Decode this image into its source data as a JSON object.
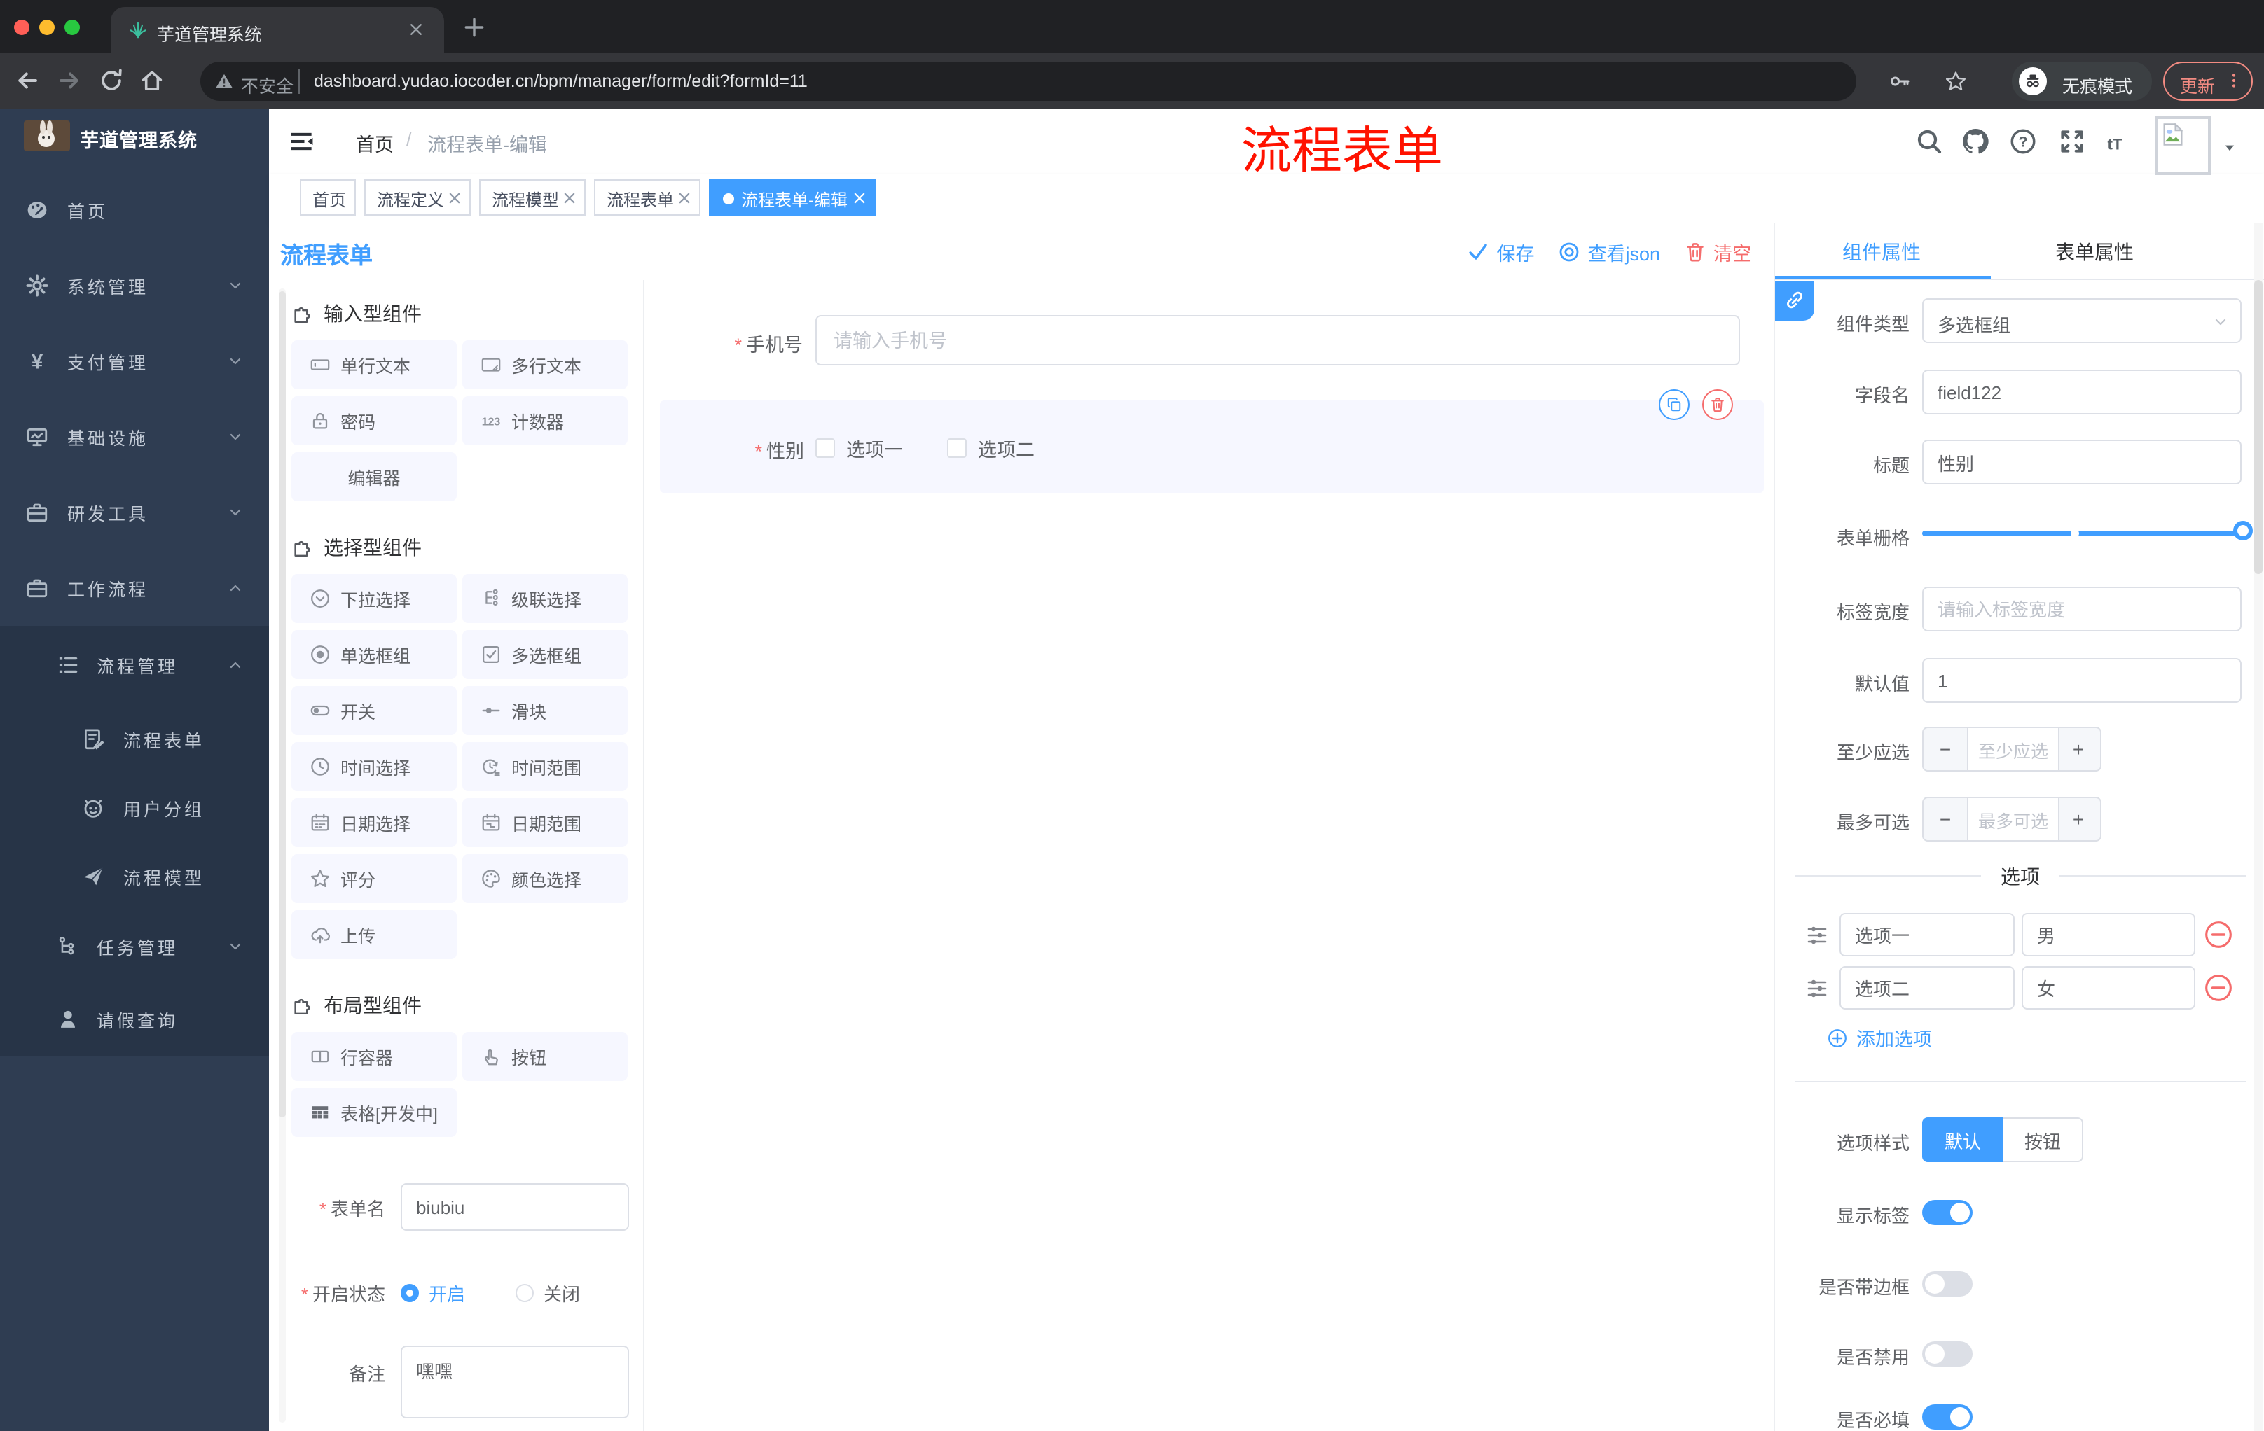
{
  "browser": {
    "tab_title": "芋道管理系统",
    "security": "不安全",
    "url": "dashboard.yudao.iocoder.cn/bpm/manager/form/edit?formId=11",
    "incognito": "无痕模式",
    "update": "更新"
  },
  "sidebar": {
    "logo": "芋道管理系统",
    "items": [
      {
        "label": "首页"
      },
      {
        "label": "系统管理"
      },
      {
        "label": "支付管理"
      },
      {
        "label": "基础设施"
      },
      {
        "label": "研发工具"
      },
      {
        "label": "工作流程"
      },
      {
        "label": "流程管理"
      },
      {
        "label": "流程表单"
      },
      {
        "label": "用户分组"
      },
      {
        "label": "流程模型"
      },
      {
        "label": "任务管理"
      },
      {
        "label": "请假查询"
      }
    ]
  },
  "header": {
    "breadcrumb_home": "首页",
    "breadcrumb_sep": "/",
    "breadcrumb_current": "流程表单-编辑",
    "annotation": "流程表单"
  },
  "tags": {
    "items": [
      {
        "label": "首页"
      },
      {
        "label": "流程定义"
      },
      {
        "label": "流程模型"
      },
      {
        "label": "流程表单"
      },
      {
        "label": "流程表单-编辑"
      }
    ]
  },
  "toolbar": {
    "title": "流程表单",
    "save": "保存",
    "view_json": "查看json",
    "clear": "清空"
  },
  "palette": {
    "sections": [
      {
        "title": "输入型组件",
        "items": [
          {
            "label": "单行文本"
          },
          {
            "label": "多行文本"
          },
          {
            "label": "密码"
          },
          {
            "label": "计数器"
          },
          {
            "label": "编辑器"
          }
        ]
      },
      {
        "title": "选择型组件",
        "items": [
          {
            "label": "下拉选择"
          },
          {
            "label": "级联选择"
          },
          {
            "label": "单选框组"
          },
          {
            "label": "多选框组"
          },
          {
            "label": "开关"
          },
          {
            "label": "滑块"
          },
          {
            "label": "时间选择"
          },
          {
            "label": "时间范围"
          },
          {
            "label": "日期选择"
          },
          {
            "label": "日期范围"
          },
          {
            "label": "评分"
          },
          {
            "label": "颜色选择"
          },
          {
            "label": "上传"
          }
        ]
      },
      {
        "title": "布局型组件",
        "items": [
          {
            "label": "行容器"
          },
          {
            "label": "按钮"
          },
          {
            "label": "表格[开发中]"
          }
        ]
      }
    ]
  },
  "meta": {
    "name_label": "表单名",
    "name_value": "biubiu",
    "status_label": "开启状态",
    "status_on": "开启",
    "status_off": "关闭",
    "remark_label": "备注",
    "remark_value": "嘿嘿"
  },
  "canvas": {
    "phone_label": "手机号",
    "phone_placeholder": "请输入手机号",
    "gender_label": "性别",
    "opt1": "选项一",
    "opt2": "选项二"
  },
  "props": {
    "tab_component": "组件属性",
    "tab_form": "表单属性",
    "type_label": "组件类型",
    "type_value": "多选框组",
    "field_label": "字段名",
    "field_value": "field122",
    "title_label": "标题",
    "title_value": "性别",
    "grid_label": "表单栅格",
    "width_label": "标签宽度",
    "width_placeholder": "请输入标签宽度",
    "default_label": "默认值",
    "default_value": "1",
    "min_label": "至少应选",
    "min_placeholder": "至少应选",
    "max_label": "最多可选",
    "max_placeholder": "最多可选",
    "options_title": "选项",
    "opt_rows": [
      {
        "label": "选项一",
        "value": "男"
      },
      {
        "label": "选项二",
        "value": "女"
      }
    ],
    "add_option": "添加选项",
    "style_label": "选项样式",
    "style_default": "默认",
    "style_button": "按钮",
    "show_label": "显示标签",
    "border_label": "是否带边框",
    "disable_label": "是否禁用",
    "required_label": "是否必填"
  },
  "colors": {
    "accent": "#409eff",
    "danger": "#f56c6c",
    "annotation_red": "#ff1200",
    "sidebar_bg": "#2f3d52",
    "submenu_bg": "#273447",
    "chrome_dark": "#202124",
    "chrome_mid": "#35363a",
    "chip_bg": "#f6f7ff",
    "update_salmon": "#f28b82"
  }
}
